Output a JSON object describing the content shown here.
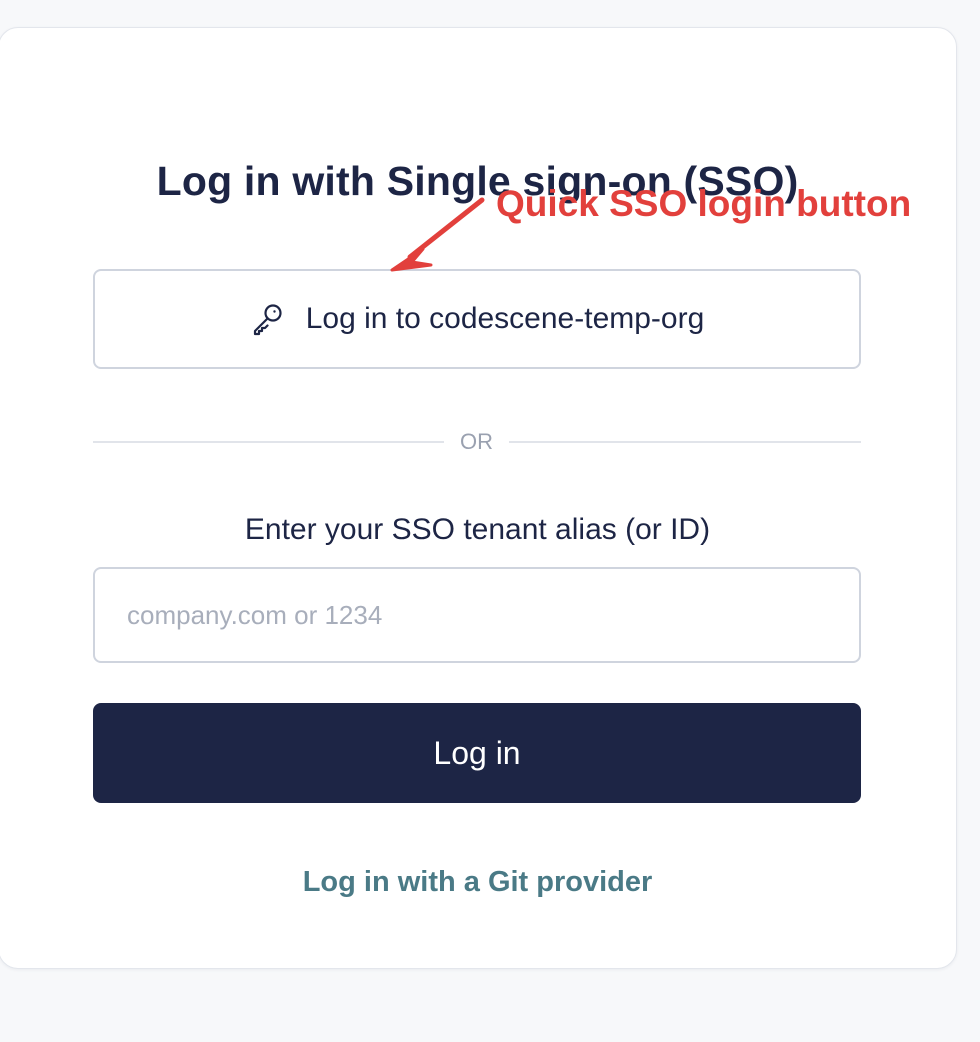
{
  "title": "Log in with Single sign-on (SSO)",
  "annotation": {
    "text": "Quick SSO login button",
    "color": "#e2403c"
  },
  "quick_sso": {
    "icon": "key-icon",
    "label": "Log in to codescene-temp-org"
  },
  "divider": {
    "text": "OR"
  },
  "tenant": {
    "label": "Enter your SSO tenant alias (or ID)",
    "value": "",
    "placeholder": "company.com or 1234"
  },
  "login_button": {
    "label": "Log in",
    "color": "#1d2545"
  },
  "git_provider_link": {
    "label": "Log in with a Git provider",
    "color": "#4a7a86"
  }
}
